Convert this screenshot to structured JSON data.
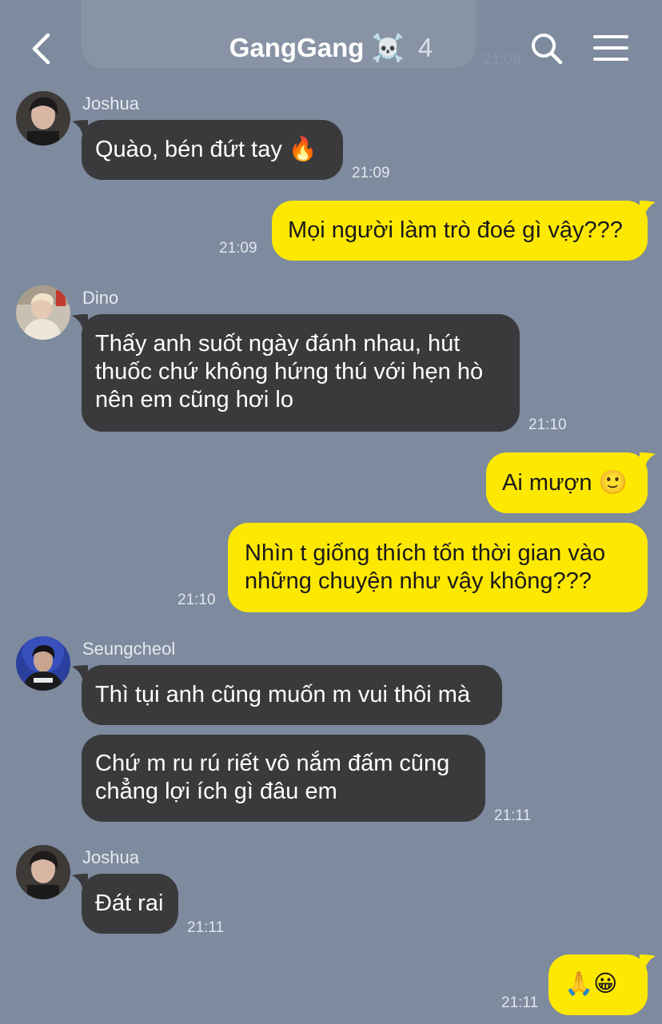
{
  "header": {
    "title": "GangGang",
    "title_emoji": "☠️",
    "member_count": "4",
    "back_icon": "chevron-left-icon",
    "search_icon": "search-icon",
    "menu_icon": "hamburger-menu-icon"
  },
  "ghost": {
    "time": "21:08"
  },
  "messages": [
    {
      "sender": "Joshua",
      "lines": [
        "Quào, bén đứt tay 🔥"
      ],
      "time": "21:09"
    },
    {
      "lines": [
        "Mọi người làm trò đoé gì vậy???"
      ],
      "time": "21:09"
    },
    {
      "sender": "Dino",
      "lines": [
        "Thấy anh suốt ngày đánh nhau, hút",
        "thuốc chứ không hứng thú với hẹn hò",
        "nên em cũng hơi lo"
      ],
      "time": "21:10"
    },
    {
      "lines": [
        "Ai mượn 🙂"
      ]
    },
    {
      "lines": [
        "Nhìn t giống thích tốn thời gian vào",
        "những chuyện như vậy không???"
      ],
      "time": "21:10"
    },
    {
      "sender": "Seungcheol",
      "lines": [
        "Thì tụi anh cũng muốn m vui thôi mà"
      ]
    },
    {
      "lines": [
        "Chứ m ru rú riết vô nắm đấm cũng",
        "chẳng lợi ích gì đâu em"
      ],
      "time": "21:11"
    },
    {
      "sender": "Joshua",
      "lines": [
        "Đát rai"
      ],
      "time": "21:11"
    },
    {
      "lines": [
        "🙏😀"
      ],
      "time": "21:11"
    }
  ]
}
